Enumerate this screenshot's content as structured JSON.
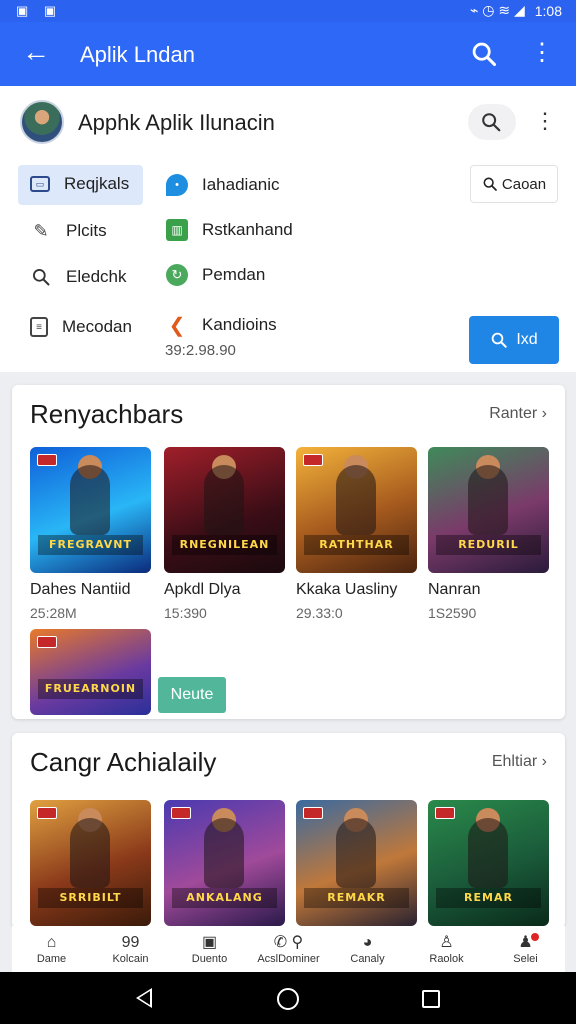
{
  "status_bar": {
    "left_icons": "▣ ▣",
    "right_icons": "⌁ ◷ ≋ ◢",
    "time": "1:08"
  },
  "app_bar": {
    "title": "Aplik Lndan",
    "back_icon": "arrow-left",
    "search_icon": "search",
    "more_icon": "more-vertical"
  },
  "header": {
    "app_name": "Apphk Aplik Ilunacin",
    "menu_left": [
      {
        "label": "Reqjkals",
        "icon": "id-card"
      },
      {
        "label": "Plcits",
        "icon": "edit"
      },
      {
        "label": "Eledchk",
        "icon": "search"
      },
      {
        "label": "Mecodan",
        "icon": "clipboard"
      }
    ],
    "menu_right": [
      {
        "label": "Iahadianic",
        "icon": "chat-bubble"
      },
      {
        "label": "Rstkanhand",
        "icon": "chart"
      },
      {
        "label": "Pemdan",
        "icon": "refresh"
      },
      {
        "label": "Kandioins",
        "icon": "diamond"
      }
    ],
    "size_text": "39:2.98.90",
    "mini_button": "Caoan",
    "blue_button": "Ixd"
  },
  "section1": {
    "title": "Renyachbars",
    "link": "Ranter",
    "games": [
      {
        "name": "Dahes Nantiid",
        "size": "25:28M",
        "art": "FREGRAVNT"
      },
      {
        "name": "Apkdl Dlya",
        "size": "15:390",
        "art": "RNEGNILEAN"
      },
      {
        "name": "Kkaka Uasliny",
        "size": "29.33:0",
        "art": "RATHTHAR"
      },
      {
        "name": "Nanran",
        "size": "1S2590",
        "art": "REDURIL"
      }
    ],
    "extra_art": "FRUEARNOIN",
    "nauto_button": "Neute"
  },
  "section2": {
    "title": "Cangr Achialaily",
    "link": "Ehltiar",
    "arts": [
      "SRRIBILT",
      "ANKALANG",
      "REMAKR",
      "REMAR"
    ]
  },
  "bottom_nav": [
    {
      "label": "Dame",
      "icon": "home-icon"
    },
    {
      "label": "Kolcain",
      "icon": "grid-icon",
      "glyph": "99"
    },
    {
      "label": "Duento",
      "icon": "square-icon"
    },
    {
      "label": "AcslDominer",
      "icon": "tools-icon"
    },
    {
      "label": "Canaly",
      "icon": "pie-icon"
    },
    {
      "label": "Raolok",
      "icon": "person-icon"
    },
    {
      "label": "Selei",
      "icon": "account-icon"
    }
  ],
  "colors": {
    "primary": "#2d68f6",
    "accent": "#1f86e6",
    "success": "#52b79a"
  }
}
